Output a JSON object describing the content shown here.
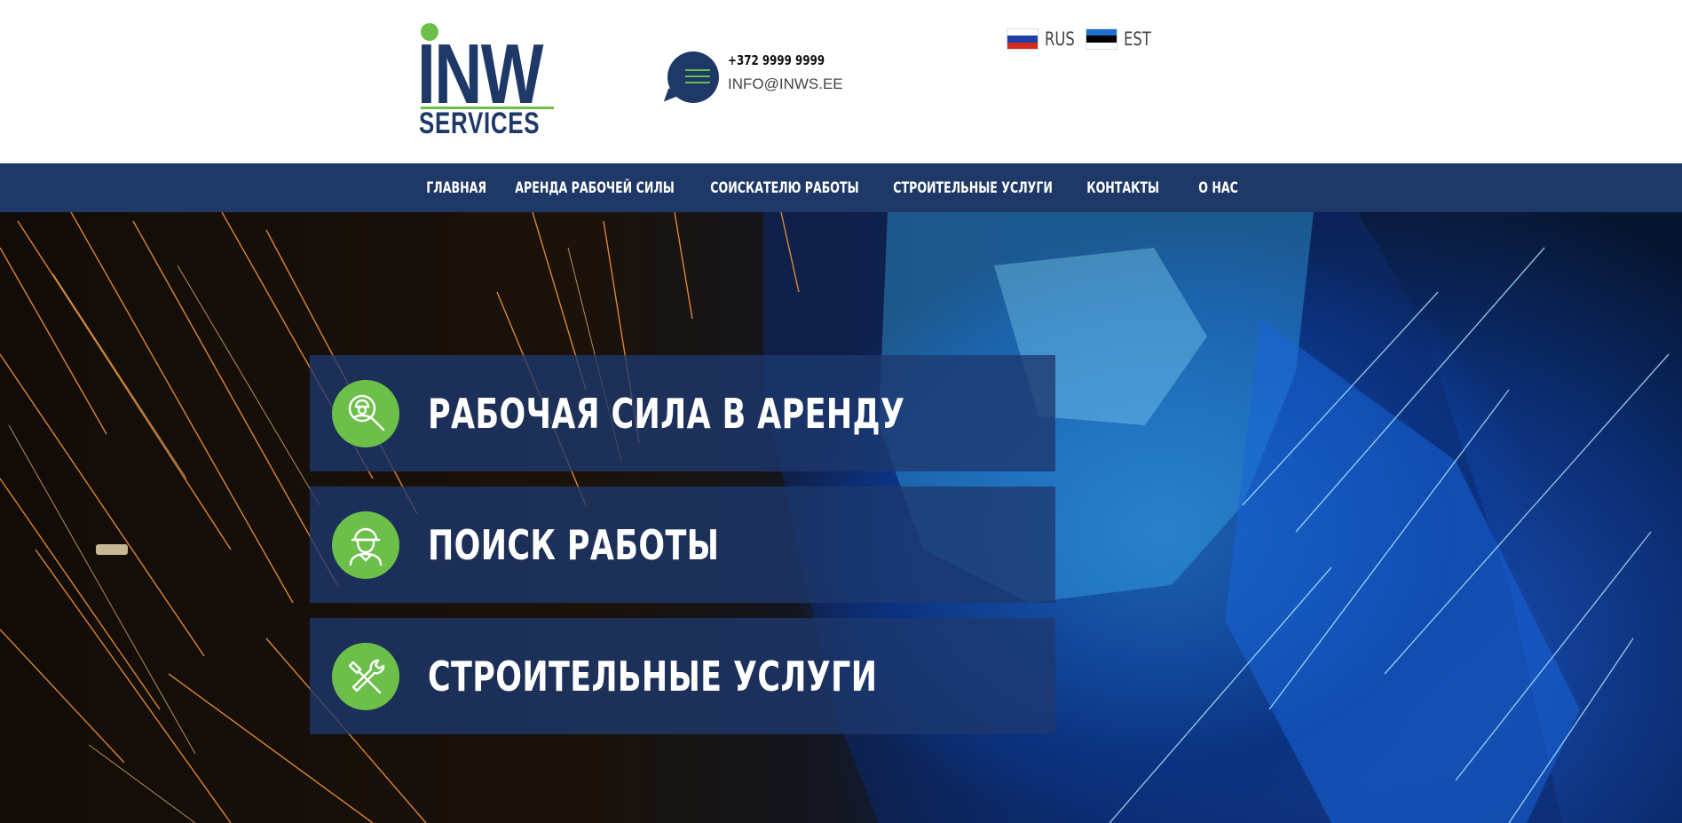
{
  "header": {
    "logo": {
      "main": "INW",
      "sub": "SERVICES"
    },
    "contact": {
      "phone": "+372 9999 9999",
      "email": "INFO@INWS.EE",
      "icon": "chat-icon"
    },
    "languages": [
      {
        "code": "RUS",
        "flag": [
          "#ffffff",
          "#1c3fa8",
          "#d52b1e"
        ]
      },
      {
        "code": "EST",
        "flag": [
          "#1f6fcf",
          "#000000",
          "#ffffff"
        ]
      }
    ]
  },
  "nav": {
    "items": [
      {
        "label": "ГЛАВНАЯ"
      },
      {
        "label": "АРЕНДА РАБОЧЕЙ СИЛЫ"
      },
      {
        "label": "СОИСКАТЕЛЮ РАБОТЫ"
      },
      {
        "label": "СТРОИТЕЛЬНЫЕ УСЛУГИ"
      },
      {
        "label": "КОНТАКТЫ"
      },
      {
        "label": "О НАС"
      }
    ]
  },
  "hero": {
    "services": [
      {
        "label": "РАБОЧАЯ СИЛА В АРЕНДУ",
        "icon": "worker-search-icon"
      },
      {
        "label": "ПОИСК РАБОТЫ",
        "icon": "worker-helmet-icon"
      },
      {
        "label": "СТРОИТЕЛЬНЫЕ УСЛУГИ",
        "icon": "tools-icon"
      }
    ]
  },
  "colors": {
    "brand_blue": "#1e3868",
    "brand_green": "#6cc04a",
    "nav_text": "#ffffff",
    "panel_overlay": "rgba(30,56,110,0.78)"
  }
}
